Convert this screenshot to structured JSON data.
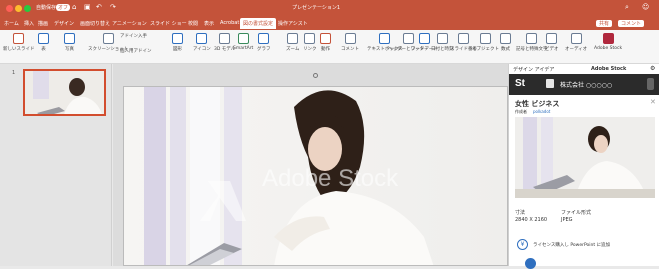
{
  "titlebar": {
    "autosave": "自動保存",
    "autosave_toggle": "オフ",
    "doc_title": "プレゼンテーション1"
  },
  "tabs": [
    "ホーム",
    "挿入",
    "描画",
    "デザイン",
    "画面切り替え",
    "アニメーション",
    "スライド ショー",
    "校閲",
    "表示",
    "Acrobat",
    "図の書式設定",
    "操作アシスト"
  ],
  "active_tab": "図の書式設定",
  "share": {
    "share_label": "共有",
    "comment_label": "コメント"
  },
  "ribbon": {
    "groups": [
      {
        "label": "新しいスライド"
      },
      {
        "label": "表"
      },
      {
        "label": "写真"
      },
      {
        "label": "スクリーンショット"
      },
      {
        "label": "アドイン入手"
      },
      {
        "label": "個人用アドイン"
      },
      {
        "label": "図形"
      },
      {
        "label": "アイコン"
      },
      {
        "label": "3D モデル"
      },
      {
        "label": "SmartArt"
      },
      {
        "label": "グラフ"
      },
      {
        "label": "ズーム"
      },
      {
        "label": "リンク"
      },
      {
        "label": "動作"
      },
      {
        "label": "コメント"
      },
      {
        "label": "テキストボックス"
      },
      {
        "label": "ヘッダーとフッター"
      },
      {
        "label": "ワードアート"
      },
      {
        "label": "日付と時刻"
      },
      {
        "label": "スライド番号"
      },
      {
        "label": "オブジェクト"
      },
      {
        "label": "数式"
      },
      {
        "label": "記号と特殊文字"
      },
      {
        "label": "ビデオ"
      },
      {
        "label": "オーディオ"
      },
      {
        "label": "Adobe Stock"
      }
    ]
  },
  "slide_panel": {
    "slide_number": "1"
  },
  "slide": {
    "watermark": "Adobe Stock"
  },
  "side_pane": {
    "tab_design": "デザイン アイデア",
    "tab_stock": "Adobe Stock",
    "logo": "St",
    "account": "株式会社 ○○○○○",
    "image_title": "女性 ビジネス",
    "author_prefix": "作成者",
    "author": "polkadot",
    "size_label": "寸法",
    "size_value": "2840 X 2160",
    "format_label": "ファイル形式",
    "format_value": "JPEG",
    "license_button": "ライセンス購入し PowerPoint に追加"
  },
  "colors": {
    "accent": "#c4533a",
    "link": "#2f6fbf"
  }
}
